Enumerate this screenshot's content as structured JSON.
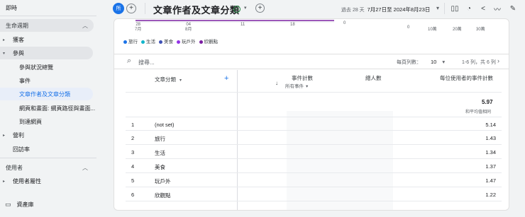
{
  "sidebar": {
    "top_item": "即時",
    "section1": "生命週期",
    "acquisition": "獲客",
    "engagement": "參與",
    "eng_items": [
      "參與狀況總覽",
      "事件",
      "文章作者及文章分類",
      "網頁和畫面: 網頁路徑與畫面...",
      "到達網頁"
    ],
    "monetization": "營利",
    "retention": "回訪率",
    "section2": "使用者",
    "user_attr": "使用者屬性",
    "library": "資產庫"
  },
  "topbar": {
    "avatar": "所",
    "title": "文章作者及文章分類",
    "date_prefix": "過去 28 天",
    "date_range": "7月27日至 2024年8月23日"
  },
  "chart": {
    "x_ticks": [
      "28\n7月",
      "04\n8月",
      "11",
      "18"
    ],
    "zero": "0",
    "bar_ticks": [
      "0",
      "10萬",
      "20萬",
      "30萬"
    ],
    "legend": [
      "旅行",
      "生活",
      "美食",
      "玩戶外",
      "欣觀點"
    ],
    "legend_colors": [
      "#1a73e8",
      "#12b5cb",
      "#3f51b5",
      "#9334e6",
      "#7b1fa2"
    ]
  },
  "table_controls": {
    "search_placeholder": "搜尋...",
    "rows_per_page_label": "每頁列數：",
    "rows_per_page": "10",
    "pagination": "1-6 列，共 6 列"
  },
  "columns": {
    "dim": "文章分類",
    "event_count": "事件計數",
    "all_events": "所有事件",
    "total_users": "總人數",
    "per_user": "每位使用者的事件計數"
  },
  "totals": {
    "per_user": "5.97",
    "per_user_note": "和平均值相同"
  },
  "rows": [
    {
      "n": "1",
      "name": "(not set)",
      "val": "5.14"
    },
    {
      "n": "2",
      "name": "旅行",
      "val": "1.43"
    },
    {
      "n": "3",
      "name": "生活",
      "val": "1.34"
    },
    {
      "n": "4",
      "name": "美食",
      "val": "1.37"
    },
    {
      "n": "5",
      "name": "玩戶外",
      "val": "1.47"
    },
    {
      "n": "6",
      "name": "欣觀點",
      "val": "1.22"
    }
  ]
}
